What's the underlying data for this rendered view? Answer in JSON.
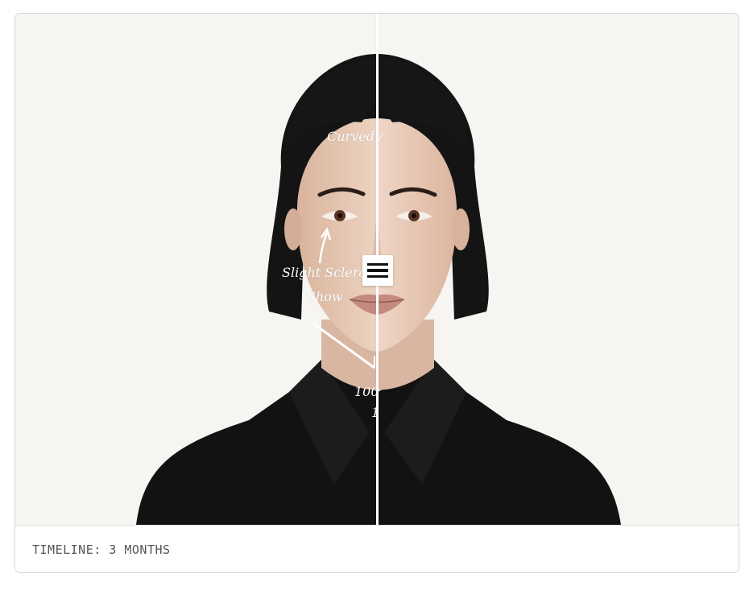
{
  "comparison": {
    "annotations": {
      "curved": "Curved /",
      "sclera_line1": "Slight Sclera",
      "sclera_line2": "Show",
      "angle": "100",
      "angle_suffix": "1"
    },
    "handle_icon": "drag-handle-icon",
    "divider_position_percent": 50
  },
  "footer": {
    "timeline_label": "TIMELINE: 3 MONTHS"
  },
  "colors": {
    "stage_background": "#f7f5f2",
    "hair": "#141414",
    "skin": "#e7c8b4",
    "shirt": "#111111",
    "annotation": "#ffffff"
  }
}
